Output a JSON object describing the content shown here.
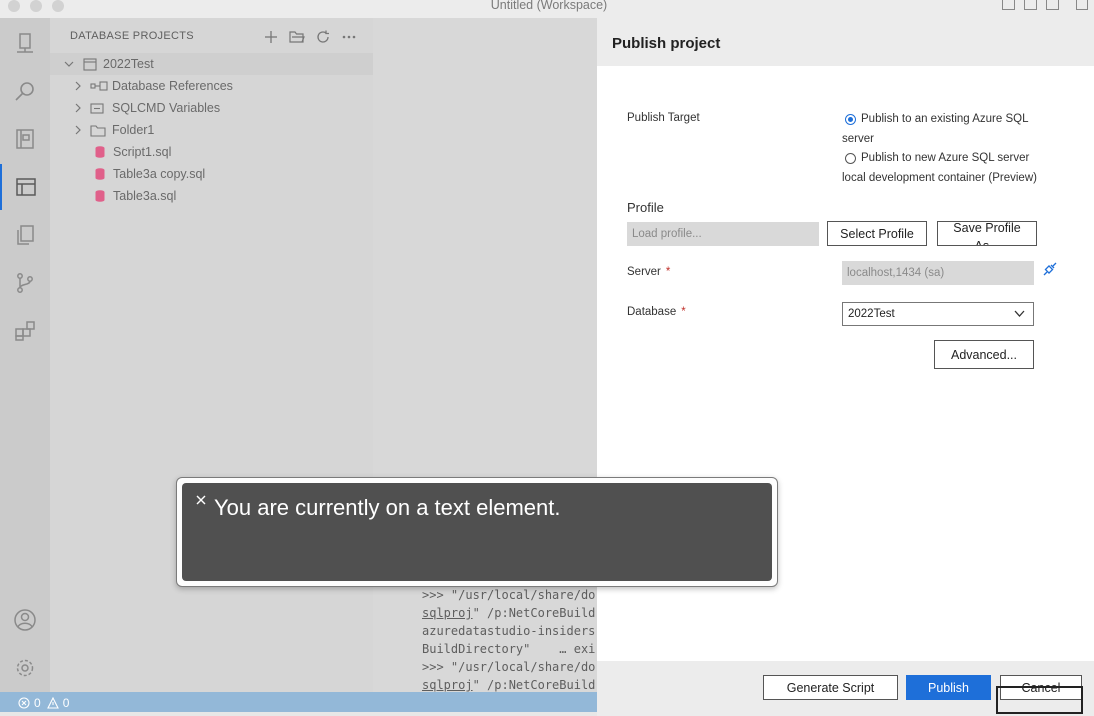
{
  "window": {
    "title": "Untitled (Workspace)"
  },
  "activity_bar": {
    "items": [
      "connections-icon",
      "search-icon",
      "notebooks-icon",
      "database-projects-icon",
      "explorer-icon",
      "source-control-icon",
      "extensions-icon"
    ],
    "bottom": [
      "account-icon",
      "settings-icon"
    ]
  },
  "sidebar": {
    "title": "DATABASE PROJECTS",
    "actions": [
      "new-project-icon",
      "open-project-icon",
      "refresh-icon",
      "more-icon"
    ],
    "tree": {
      "project": "2022Test",
      "items": [
        {
          "label": "Database References",
          "icon": "references-icon"
        },
        {
          "label": "SQLCMD Variables",
          "icon": "variables-icon"
        },
        {
          "label": "Folder1",
          "icon": "folder-icon"
        },
        {
          "label": "Script1.sql",
          "icon": "sql-file-icon"
        },
        {
          "label": "Table3a copy.sql",
          "icon": "sql-file-icon"
        },
        {
          "label": "Table3a.sql",
          "icon": "sql-file-icon"
        }
      ]
    }
  },
  "terminal": {
    "line1": ">>> \"/usr/local/share/do",
    "line2a": "sqlproj",
    "line2b": "\" /p:NetCoreBuild",
    "line3": "azuredatastudio-insiders",
    "line4": "BuildDirectory\"    … exi",
    "line5": ">>> \"/usr/local/share/do",
    "line6a": "sqlproj",
    "line6b": "\" /p:NetCoreBuild"
  },
  "status_bar": {
    "errors": "0",
    "warnings": "0"
  },
  "publish": {
    "title": "Publish project",
    "target_label": "Publish Target",
    "option1_line1": "Publish to an existing Azure SQL",
    "option1_line2": "server",
    "option2_line1": "Publish to new Azure SQL server",
    "option2_line2": "local development container (Preview)",
    "profile_heading": "Profile",
    "profile_placeholder": "Load profile...",
    "select_profile": "Select Profile",
    "save_profile_line1": "Save Profile",
    "save_profile_line2": "As...",
    "server_label": "Server",
    "server_value": "localhost,1434 (sa)",
    "database_label": "Database",
    "database_value": "2022Test",
    "advanced": "Advanced...",
    "generate_script": "Generate Script",
    "publish": "Publish",
    "cancel": "Cancel",
    "accent": "#1e6fd9"
  },
  "toast": {
    "message": "You are currently on a text element."
  }
}
